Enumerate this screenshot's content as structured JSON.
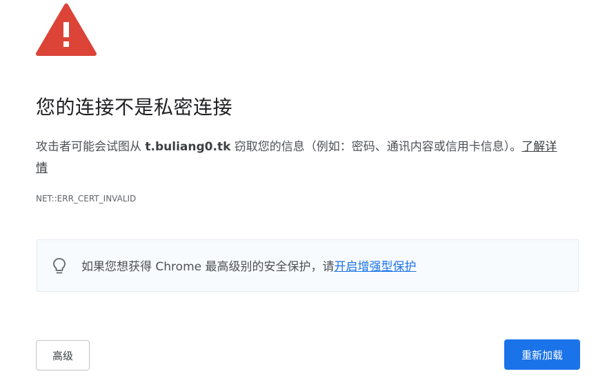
{
  "colors": {
    "warning_red": "#db4437",
    "link_blue": "#1a73e8",
    "primary_button": "#1a73e8",
    "hint_background": "#f8fbfe"
  },
  "icons": {
    "warning": "warning-triangle-icon",
    "hint": "lightbulb-icon"
  },
  "title": "您的连接不是私密连接",
  "description": {
    "before": "攻击者可能会试图从 ",
    "domain": "t.buliang0.tk",
    "after": " 窃取您的信息（例如：密码、通讯内容或信用卡信息）。",
    "learn_more": "了解详情"
  },
  "error_code": "NET::ERR_CERT_INVALID",
  "hint": {
    "text": "如果您想获得 Chrome 最高级别的安全保护，请",
    "link": "开启增强型保护"
  },
  "buttons": {
    "advanced": "高级",
    "reload": "重新加载"
  }
}
